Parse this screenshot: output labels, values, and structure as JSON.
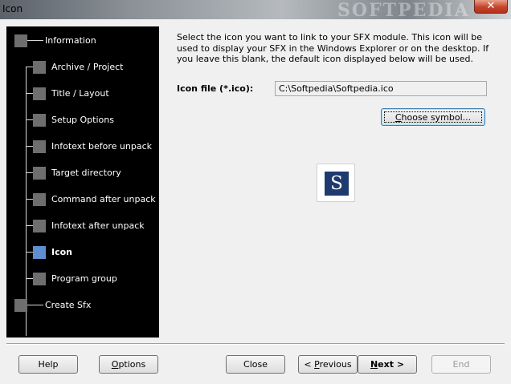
{
  "window": {
    "title": "Icon",
    "close_label": "✕",
    "watermark": "SOFTPEDIA"
  },
  "sidebar": {
    "items": [
      {
        "label": "Information",
        "level": 0,
        "active": false
      },
      {
        "label": "Archive / Project",
        "level": 1,
        "active": false
      },
      {
        "label": "Title / Layout",
        "level": 1,
        "active": false
      },
      {
        "label": "Setup Options",
        "level": 1,
        "active": false
      },
      {
        "label": "Infotext before unpack",
        "level": 1,
        "active": false
      },
      {
        "label": "Target directory",
        "level": 1,
        "active": false
      },
      {
        "label": "Command after unpack",
        "level": 1,
        "active": false
      },
      {
        "label": "Infotext after unpack",
        "level": 1,
        "active": false
      },
      {
        "label": "Icon",
        "level": 1,
        "active": true
      },
      {
        "label": "Program group",
        "level": 1,
        "active": false
      },
      {
        "label": "Create Sfx",
        "level": 0,
        "active": false
      }
    ]
  },
  "main": {
    "description": "Select the icon you want to link to your SFX module. This icon will be used to display your SFX in the Windows Explorer or on the desktop. If you leave this blank, the default icon displayed below will be used.",
    "icon_file_label": "Icon file (*.ico):",
    "icon_file_value": "C:\\Softpedia\\Softpedia.ico",
    "choose_symbol_label": "Choose symbol...",
    "preview_letter": "S",
    "preview_color": "#1e3a6e"
  },
  "footer": {
    "help_label": "Help",
    "options_label": "Options",
    "close_label": "Close",
    "previous_label": "< Previous",
    "next_label": "Next >",
    "end_label": "End"
  },
  "colors": {
    "sidebar_bg": "#000000",
    "node_default": "#6e6e6e",
    "node_active": "#5f8fd1"
  }
}
